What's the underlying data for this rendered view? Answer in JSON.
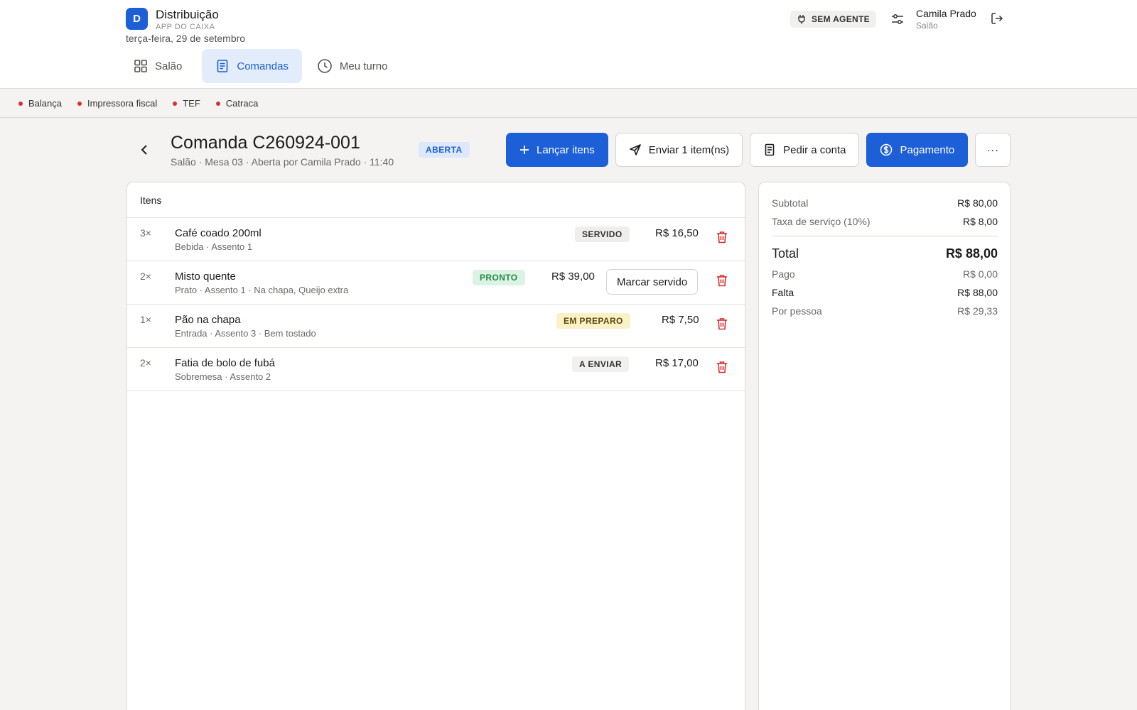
{
  "brand": {
    "logo_letter": "D",
    "name": "Distribuição",
    "subtitle": "APP DO CAIXA"
  },
  "date": "terça-feira, 29 de setembro",
  "tabs": [
    {
      "label": "Salão",
      "icon": "grid-icon",
      "active": false
    },
    {
      "label": "Comandas",
      "icon": "receipt-icon",
      "active": true
    },
    {
      "label": "Meu turno",
      "icon": "clock-icon",
      "active": false
    }
  ],
  "agent_badge": "SEM AGENTE",
  "user": {
    "name": "Camila Prado",
    "role": "Salão"
  },
  "devices": [
    {
      "label": "Balança",
      "status_color": "#d63030"
    },
    {
      "label": "Impressora fiscal",
      "status_color": "#d63030"
    },
    {
      "label": "TEF",
      "status_color": "#d63030"
    },
    {
      "label": "Catraca",
      "status_color": "#d63030"
    }
  ],
  "order": {
    "title": "Comanda C260924-001",
    "subtitle": "Salão · Mesa 03 · Aberta por Camila Prado · 11:40",
    "status": "ABERTA"
  },
  "actions": {
    "add_items": "Lançar itens",
    "send_items": "Enviar 1 item(ns)",
    "request_bill": "Pedir a conta",
    "payment": "Pagamento",
    "more": "···"
  },
  "items_header": "Itens",
  "items": [
    {
      "qty": "3×",
      "name": "Café coado 200ml",
      "desc": "Bebida · Assento 1",
      "status": "SERVIDO",
      "price": "R$ 16,50"
    },
    {
      "qty": "2×",
      "name": "Misto quente",
      "desc": "Prato · Assento 1 · Na chapa, Queijo extra",
      "status": "PRONTO",
      "price": "R$ 39,00",
      "action": "Marcar servido"
    },
    {
      "qty": "1×",
      "name": "Pão na chapa",
      "desc": "Entrada · Assento 3 · Bem tostado",
      "status": "EM PREPARO",
      "price": "R$ 7,50"
    },
    {
      "qty": "2×",
      "name": "Fatia de bolo de fubá",
      "desc": "Sobremesa · Assento 2",
      "status": "A ENVIAR",
      "price": "R$ 17,00"
    }
  ],
  "summary": {
    "subtotal": {
      "label": "Subtotal",
      "value": "R$ 80,00"
    },
    "service": {
      "label": "Taxa de serviço (10%)",
      "value": "R$ 8,00"
    },
    "total": {
      "label": "Total",
      "value": "R$ 88,00"
    },
    "paid": {
      "label": "Pago",
      "value": "R$ 0,00"
    },
    "remaining": {
      "label": "Falta",
      "value": "R$ 88,00"
    },
    "per_person": {
      "label": "Por pessoa",
      "value": "R$ 29,33"
    }
  },
  "colors": {
    "accent": "#1d5fd6",
    "danger": "#d63030",
    "ready": "#1f8a45"
  }
}
